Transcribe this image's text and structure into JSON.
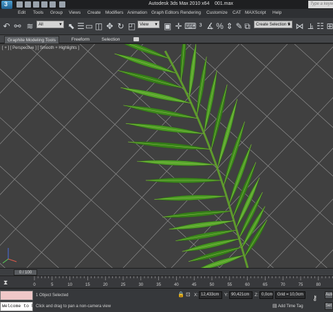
{
  "window": {
    "title": "Autodesk 3ds Max 2010 x64",
    "file": "001.max",
    "help_search_placeholder": "Type a keyword"
  },
  "menu": [
    "Edit",
    "Tools",
    "Group",
    "Views",
    "Create",
    "Modifiers",
    "Animation",
    "Graph Editors",
    "Rendering",
    "Customize",
    "CAT",
    "MAXScript",
    "Help"
  ],
  "toolbar": {
    "selection_filter": "All",
    "reference_coord": "View",
    "named_selection_set": "Create Selection S"
  },
  "ribbon": {
    "tabs": [
      "Graphite Modeling Tools",
      "Freeform",
      "Selection"
    ]
  },
  "viewport": {
    "label": "[ + ] [ Perspective ] [ Smooth + Highlights ]"
  },
  "timeline": {
    "frame": "0 / 100",
    "ticks": [
      "0",
      "5",
      "10",
      "15",
      "20",
      "25",
      "30",
      "35",
      "40",
      "45",
      "50",
      "55",
      "60",
      "65",
      "70",
      "75",
      "80",
      "85"
    ]
  },
  "status": {
    "maxscript_listener": "Welcome to M",
    "selected": "1 Object Selected",
    "prompt": "Click and drag to pan a non-camera view",
    "x_label": "X:",
    "x_value": "12,433cm",
    "y_label": "Y:",
    "y_value": "90,421cm",
    "z_label": "Z:",
    "z_value": "0,0cm",
    "grid": "Grid = 10,0cm",
    "add_time_tag": "Add Time Tag",
    "auto_key": "Auto",
    "set_key": "Set K"
  },
  "colors": {
    "viewport_bg": "#404040",
    "grid_line": "#8c8c8c",
    "leaf_green": "#3e8a1e"
  }
}
